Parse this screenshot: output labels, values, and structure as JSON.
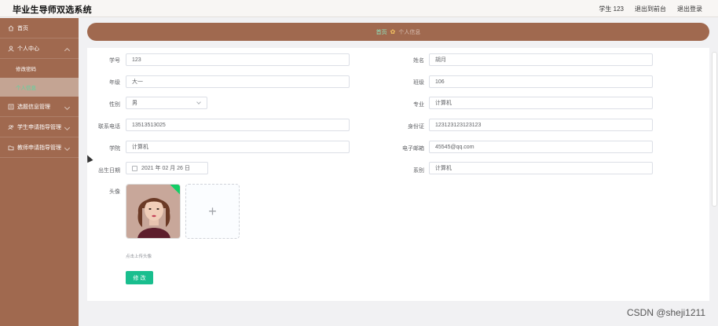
{
  "header": {
    "title": "毕业生导师双选系统",
    "user": "学生 123",
    "frontend_link": "退出到前台",
    "logout_link": "退出登录"
  },
  "sidebar": {
    "items": [
      {
        "label": "首页",
        "icon": "home-icon"
      },
      {
        "label": "个人中心",
        "icon": "user-icon"
      },
      {
        "label": "修改密码"
      },
      {
        "label": "个人信息"
      },
      {
        "label": "选题信息管理",
        "icon": "list-icon"
      },
      {
        "label": "学生申请指导管理",
        "icon": "people-icon"
      },
      {
        "label": "教师申请指导管理",
        "icon": "folder-icon"
      }
    ]
  },
  "breadcrumb": {
    "home": "首页",
    "current": "个人信息"
  },
  "form": {
    "student_id_label": "学号",
    "student_id_value": "123",
    "name_label": "姓名",
    "name_value": "胡月",
    "grade_label": "年级",
    "grade_value": "大一",
    "class_label": "班级",
    "class_value": "106",
    "gender_label": "性别",
    "gender_value": "男",
    "major_label": "专业",
    "major_value": "计算机",
    "phone_label": "联系电话",
    "phone_value": "13513513025",
    "idcard_label": "身份证",
    "idcard_value": "123123123123123",
    "college_label": "学院",
    "college_value": "计算机",
    "email_label": "电子邮箱",
    "email_value": "45545@qq.com",
    "birth_label": "出生日期",
    "birth_value": "2021 年 02 月 26 日",
    "dept_label": "系别",
    "dept_value": "计算机",
    "avatar_label": "头像",
    "upload_plus": "+",
    "upload_tip": "点击上传头像",
    "submit_label": "修 改"
  },
  "watermark": "CSDN @sheji1211",
  "colors": {
    "sidebar": "#a0694f",
    "accent": "#19be8e",
    "active_text": "#56d8a0"
  }
}
